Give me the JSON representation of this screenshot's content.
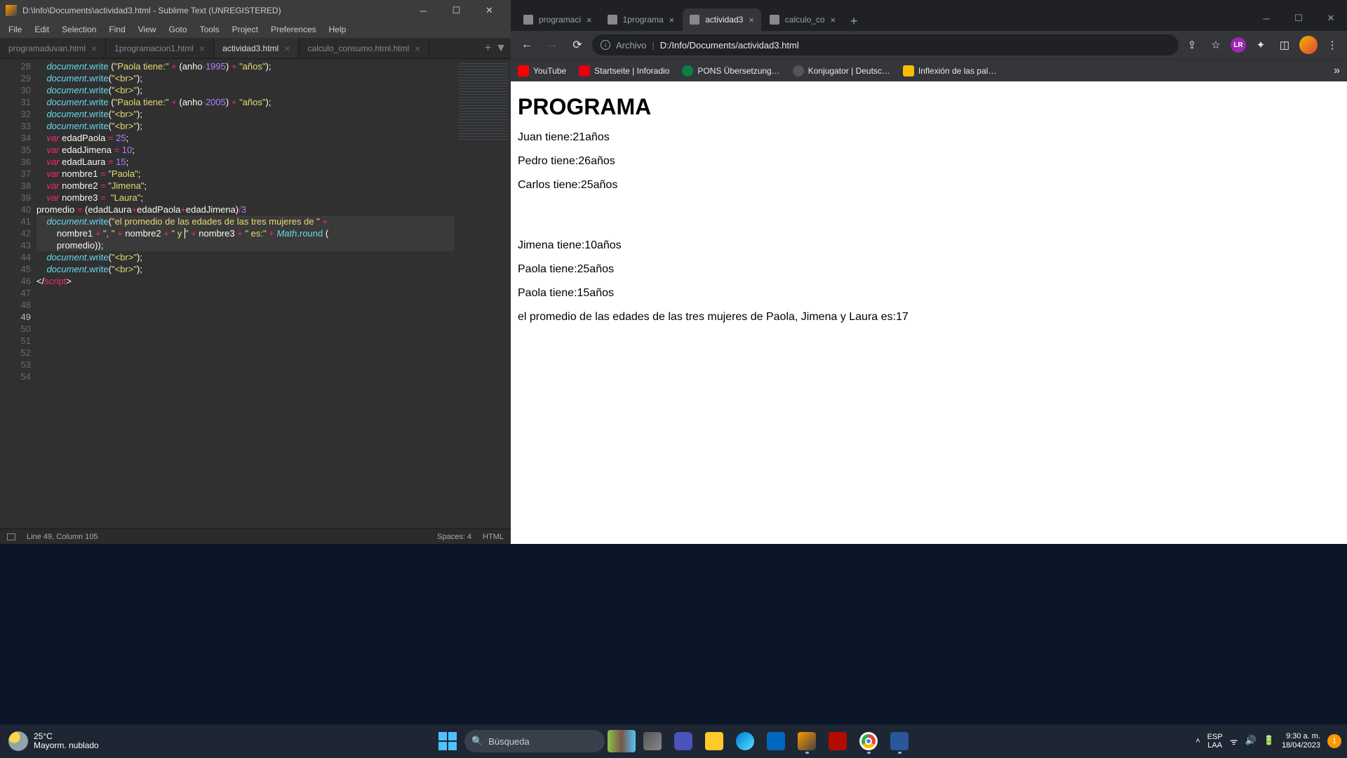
{
  "sublime": {
    "title": "D:\\Info\\Documents\\actividad3.html - Sublime Text (UNREGISTERED)",
    "menu": [
      "File",
      "Edit",
      "Selection",
      "Find",
      "View",
      "Goto",
      "Tools",
      "Project",
      "Preferences",
      "Help"
    ],
    "tabs": [
      {
        "label": "programaduvan.html",
        "active": false
      },
      {
        "label": "1programacion1.html",
        "active": false
      },
      {
        "label": "actividad3.html",
        "active": true
      },
      {
        "label": "calculo_consumo.html.html",
        "active": false
      }
    ],
    "status": {
      "pos": "Line 49, Column 105",
      "spaces": "Spaces: 4",
      "lang": "HTML"
    },
    "lines_start": 28,
    "lines_end": 54
  },
  "chrome": {
    "tabs": [
      {
        "label": "programaci",
        "active": false
      },
      {
        "label": "1programa",
        "active": false
      },
      {
        "label": "actividad3",
        "active": true
      },
      {
        "label": "calculo_co",
        "active": false
      }
    ],
    "addr_prefix": "Archivo",
    "addr_path": "D:/Info/Documents/actividad3.html",
    "profile_badge": "LR",
    "bookmarks": [
      {
        "label": "YouTube",
        "cls": "yt"
      },
      {
        "label": "Startseite | Inforadio",
        "cls": "rbb"
      },
      {
        "label": "PONS Übersetzung…",
        "cls": "pons"
      },
      {
        "label": "Konjugator | Deutsc…",
        "cls": "konj"
      },
      {
        "label": "Inflexión de las pal…",
        "cls": "infl"
      }
    ]
  },
  "page": {
    "h1": "PROGRAMA",
    "lines": [
      "Juan tiene:21años",
      "Pedro tiene:26años",
      "Carlos tiene:25años",
      "",
      "Jimena tiene:10años",
      "Paola tiene:25años",
      "Paola tiene:15años",
      "el promedio de las edades de las tres mujeres de Paola, Jimena y Laura es:17"
    ]
  },
  "taskbar": {
    "temp": "25°C",
    "weather": "Mayorm. nublado",
    "search": "Búsqueda",
    "lang1": "ESP",
    "lang2": "LAA",
    "time": "9:30 a. m.",
    "date": "18/04/2023",
    "notif": "1"
  }
}
